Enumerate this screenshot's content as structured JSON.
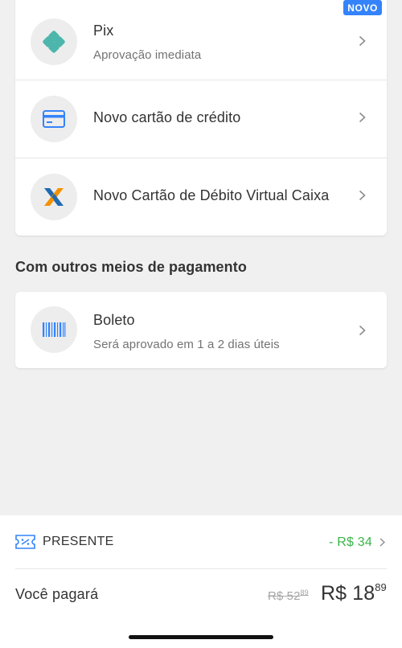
{
  "payment_methods": [
    {
      "title": "Pix",
      "subtitle": "Aprovação imediata",
      "icon": "pix-icon",
      "badge": "NOVO"
    },
    {
      "title": "Novo cartão de crédito",
      "icon": "credit-card-icon"
    },
    {
      "title": "Novo Cartão de Débito Virtual Caixa",
      "icon": "caixa-logo-icon"
    }
  ],
  "other_section": {
    "title": "Com outros meios de pagamento",
    "items": [
      {
        "title": "Boleto",
        "subtitle": "Será aprovado em 1 a 2 dias úteis",
        "icon": "barcode-icon"
      }
    ]
  },
  "footer": {
    "gift_label": "PRESENTE",
    "gift_discount": "- R$ 34",
    "pay_label": "Você pagará",
    "old_price": {
      "main": "R$ 52",
      "cents": "89"
    },
    "new_price": {
      "main": "R$ 18",
      "cents": "89"
    }
  },
  "colors": {
    "accent_blue": "#3483fa",
    "discount_green": "#39b54a",
    "pix_teal": "#4db6ac",
    "caixa_blue": "#1f6ab0",
    "caixa_orange": "#f39200"
  }
}
